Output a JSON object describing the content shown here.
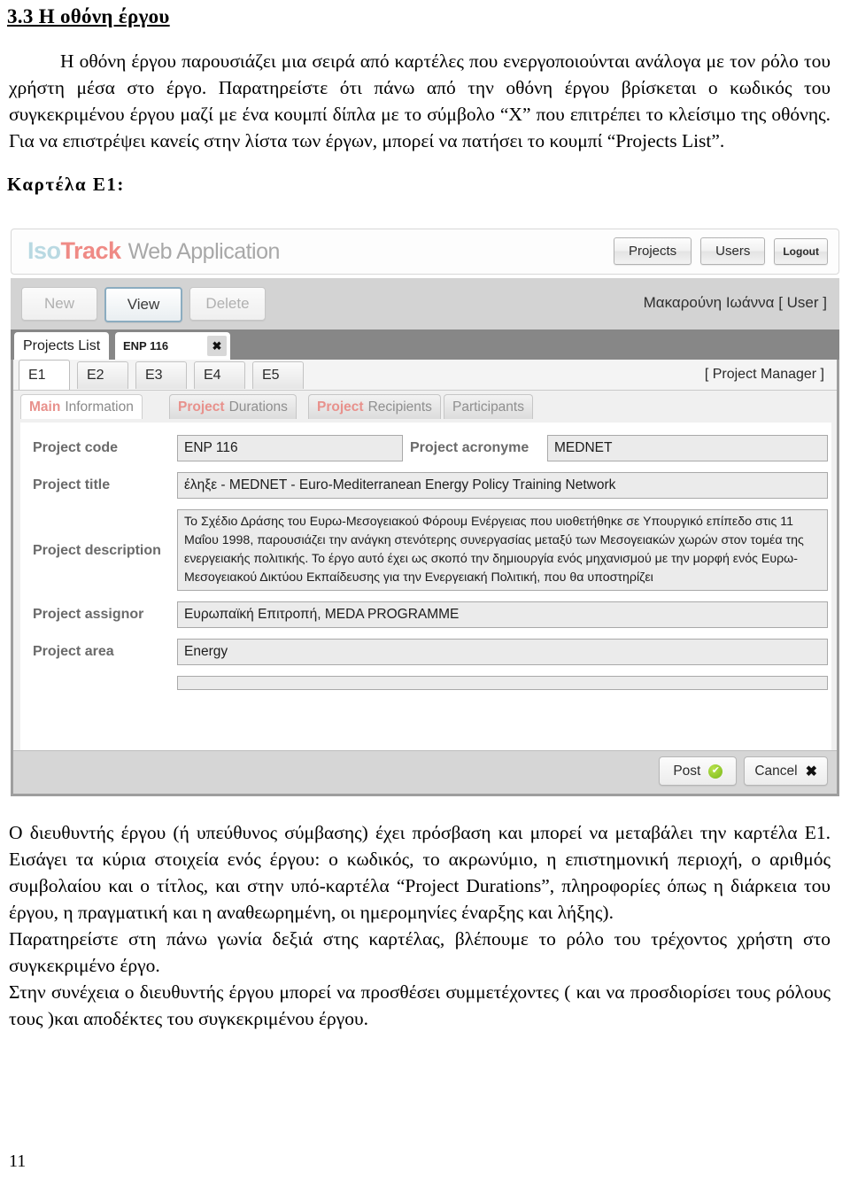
{
  "document": {
    "section_heading": "3.3 Η οθόνη έργου",
    "paragraph_1": "Η οθόνη έργου παρουσιάζει μια σειρά από καρτέλες που ενεργοποιούνται ανάλογα με τον ρόλο του χρήστη μέσα στο έργο. Παρατηρείστε ότι πάνω από την οθόνη έργου βρίσκεται ο κωδικός του συγκεκριμένου έργου μαζί με ένα κουμπί δίπλα με το σύμβολο “X” που επιτρέπει το κλείσιμο της οθόνης. Για να επιστρέψει κανείς στην λίστα των έργων, μπορεί να πατήσει το κουμπί “Projects List”.",
    "subheading": "Καρτέλα Ε1:",
    "paragraph_2": "Ο διευθυντής έργου (ή υπεύθυνος σύμβασης) έχει πρόσβαση και μπορεί να μεταβάλει την καρτέλα Ε1. Εισάγει τα κύρια στοιχεία ενός έργου: ο κωδικός, το ακρωνύμιο, η επιστημονική περιοχή, ο αριθμός συμβολαίου και ο τίτλος, και στην υπό-καρτέλα “Project Durations”, πληροφορίες όπως η διάρκεια του έργου, η πραγματική και η αναθεωρημένη, οι ημερομηνίες έναρξης και λήξης).",
    "paragraph_3": "Παρατηρείστε στη πάνω γωνία δεξιά στης καρτέλας, βλέπουμε το ρόλο του τρέχοντος χρήστη στο συγκεκριμένο έργο.",
    "paragraph_4": "Στην συνέχεια ο διευθυντής έργου μπορεί να προσθέσει συμμετέχοντες ( και να προσδιορίσει τους ρόλους τους )και αποδέκτες του συγκεκριμένου έργου.",
    "page_number": "11"
  },
  "app": {
    "brand": {
      "logo_part1": "Iso",
      "logo_part2": "Track",
      "logo_suffix": "Web Application",
      "color_part1": "#b9d9e2",
      "color_part2": "#ef8a85"
    },
    "header_buttons": [
      {
        "label": "Projects"
      },
      {
        "label": "Users"
      },
      {
        "label": "Logout"
      }
    ],
    "toolbar": {
      "buttons": [
        {
          "label": "New",
          "state": "disabled"
        },
        {
          "label": "View",
          "state": "active"
        },
        {
          "label": "Delete",
          "state": "disabled"
        }
      ],
      "user_label": "Μακαρούνη Ιωάννα  [ User ]"
    },
    "tabstrip": {
      "projects_list_label": "Projects List",
      "project_tab_label": "ENP 116",
      "close_icon": "✖"
    },
    "etabs": [
      {
        "label": "E1",
        "selected": true
      },
      {
        "label": "E2",
        "selected": false
      },
      {
        "label": "E3",
        "selected": false
      },
      {
        "label": "E4",
        "selected": false
      },
      {
        "label": "E5",
        "selected": false
      }
    ],
    "role_label": "[ Project Manager ]",
    "subtabs": [
      {
        "bold": "Main",
        "normal": "Information",
        "selected": true
      },
      {
        "bold": "Project",
        "normal": "Durations",
        "selected": false
      },
      {
        "bold": "Project",
        "normal": "Recipients",
        "selected": false
      },
      {
        "bold": "",
        "normal": "Participants",
        "selected": false
      }
    ],
    "form": {
      "project_code_label": "Project code",
      "project_code_value": "ENP 116",
      "project_acronyme_label": "Project acronyme",
      "project_acronyme_value": "MEDNET",
      "project_title_label": "Project title",
      "project_title_value": "έληξε -  MEDNET   -   Euro-Mediterranean Energy Policy Training Network",
      "project_description_label": "Project description",
      "project_description_value": "Το Σχέδιο Δράσης του Ευρω-Μεσογειακού Φόρουμ Ενέργειας που υιοθετήθηκε σε Υπουργικό επίπεδο στις 11 Μαΐου 1998, παρουσιάζει την ανάγκη στενότερης συνεργασίας μεταξύ των Μεσογειακών χωρών στον τομέα της ενεργειακής πολιτικής. Το έργο αυτό έχει ως σκοπό την δημιουργία ενός μηχανισμού με την μορφή ενός Ευρω-Μεσογειακού Δικτύου Εκπαίδευσης για την Ενεργειακή Πολιτική, που θα υποστηρίζει",
      "project_assignor_label": "Project assignor",
      "project_assignor_value": "Ευρωπαϊκή Επιτροπή, MEDA PROGRAMME",
      "project_area_label": "Project area",
      "project_area_value": "Energy"
    },
    "footer_buttons": [
      {
        "label": "Post",
        "icon": "check-circle-icon",
        "glyph": "✔"
      },
      {
        "label": "Cancel",
        "icon": "x-icon",
        "glyph": "✖"
      }
    ]
  }
}
